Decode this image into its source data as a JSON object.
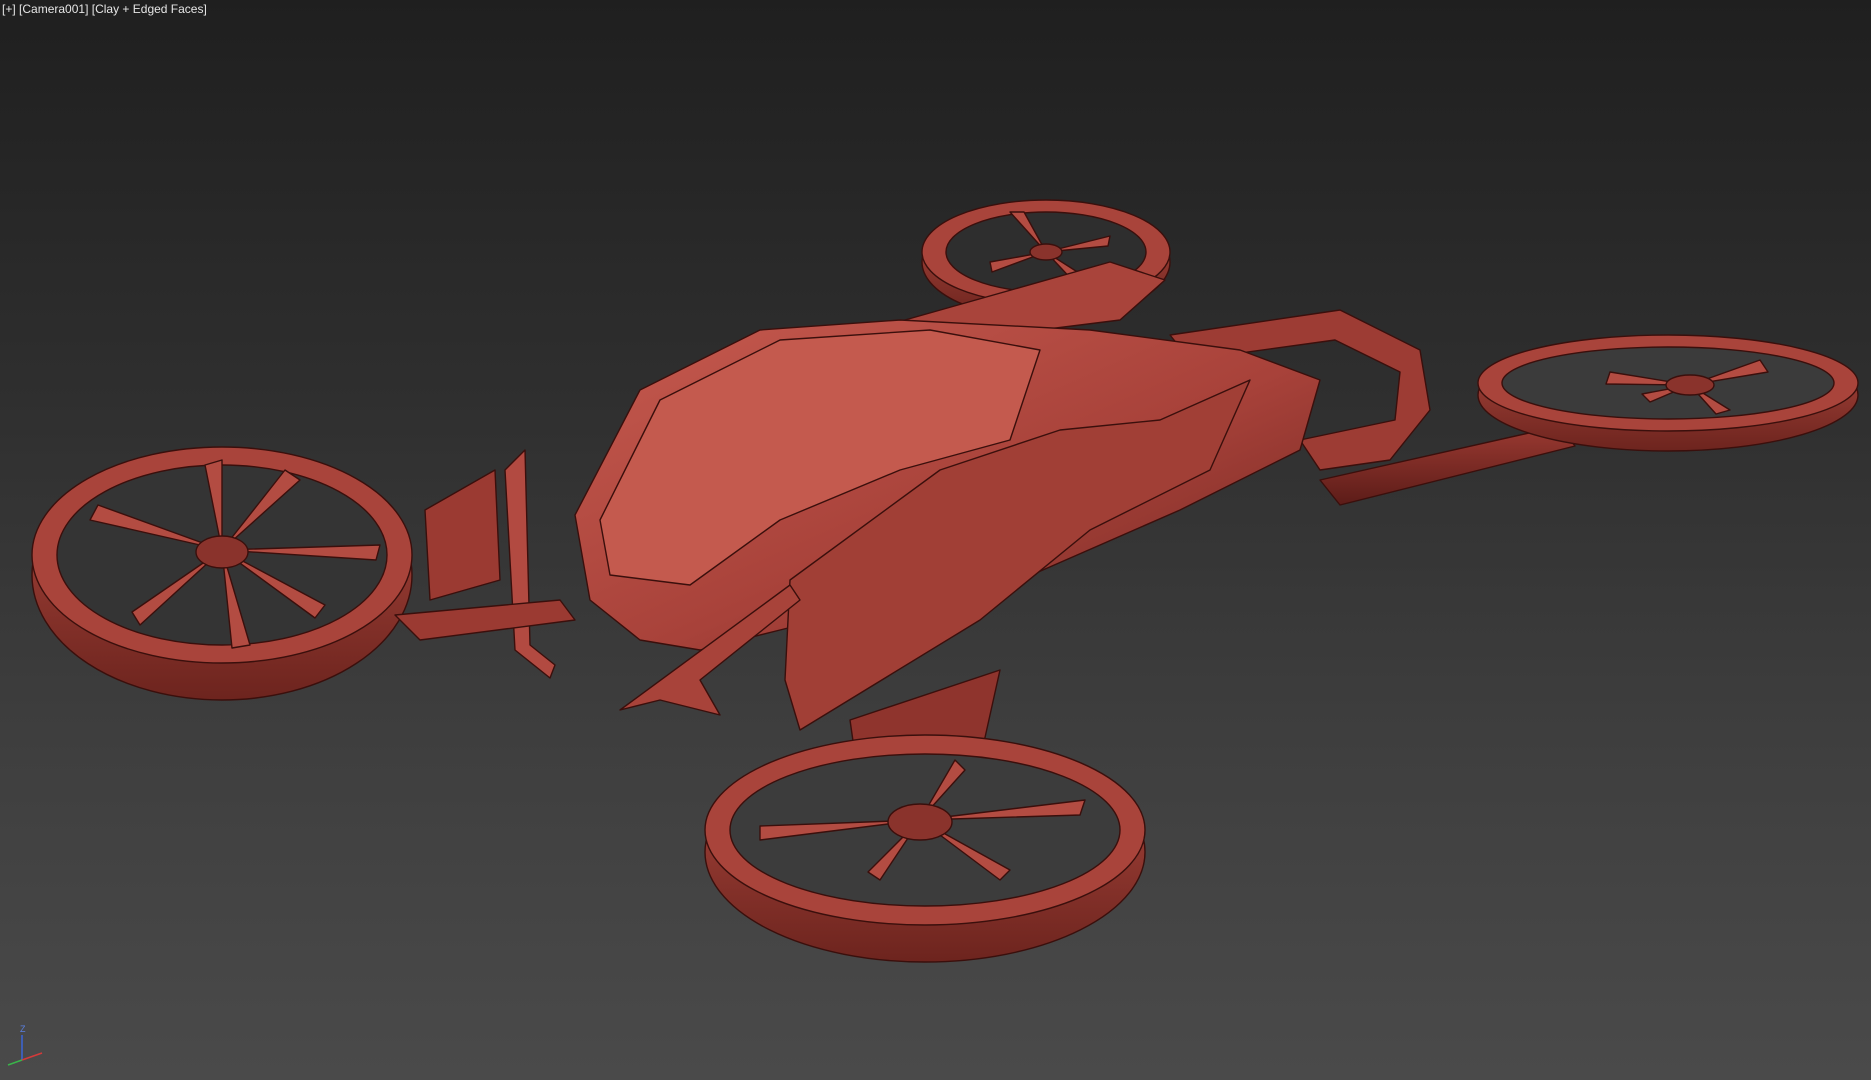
{
  "viewport": {
    "menu_label": "[+]",
    "camera_label": "[Camera001]",
    "shading_label": "[Clay + Edged Faces]"
  },
  "gizmo": {
    "z_label": "Z",
    "colors": {
      "x": "#d43a3a",
      "y": "#3ab44a",
      "z": "#3a66d8"
    }
  },
  "scene": {
    "clay_color": "#b5483f",
    "edge_color": "#3a0f0c",
    "object": "drone-model"
  }
}
